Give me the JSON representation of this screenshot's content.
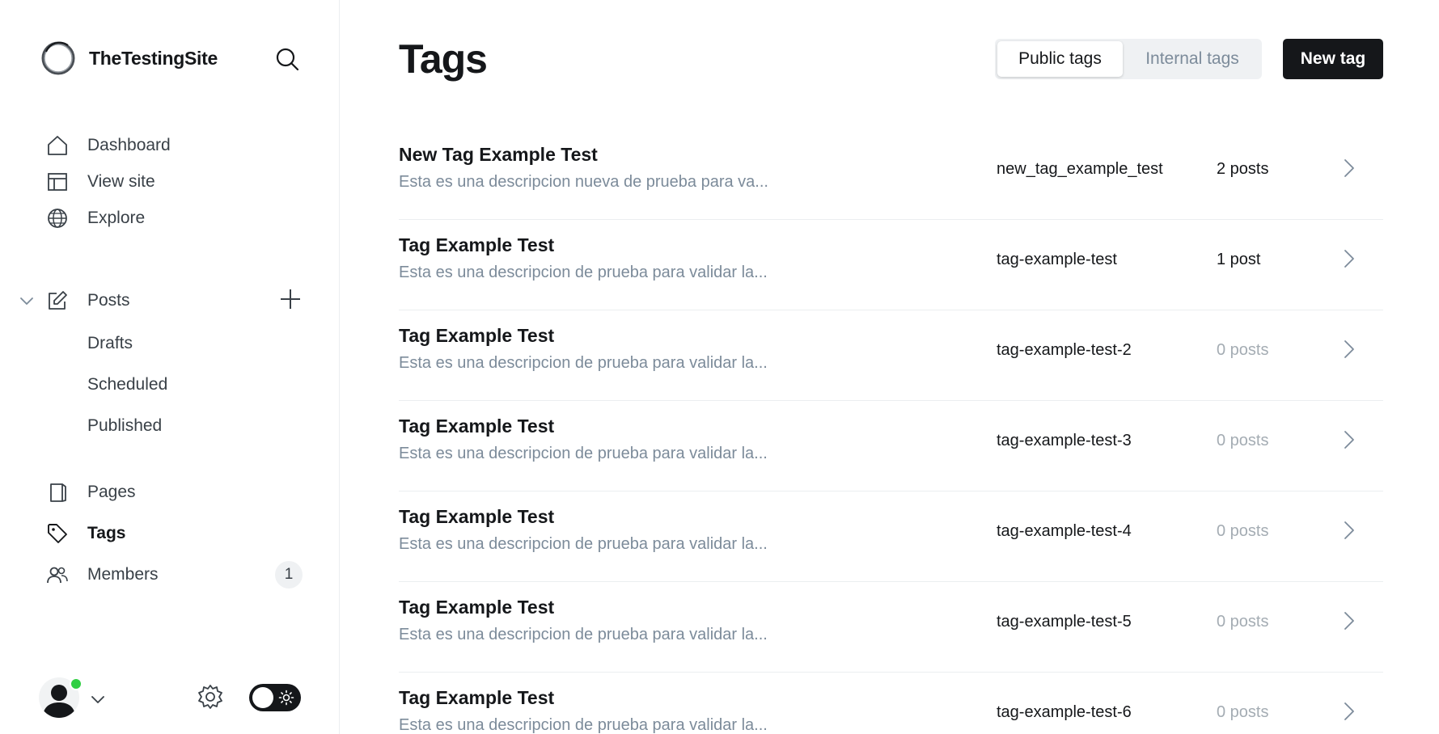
{
  "site": {
    "name": "TheTestingSite"
  },
  "nav": {
    "dashboard": "Dashboard",
    "view_site": "View site",
    "explore": "Explore",
    "posts": "Posts",
    "drafts": "Drafts",
    "scheduled": "Scheduled",
    "published": "Published",
    "pages": "Pages",
    "tags": "Tags",
    "members": "Members",
    "members_count": "1",
    "active_item": "tags"
  },
  "header": {
    "title": "Tags",
    "tabs": [
      {
        "label": "Public tags",
        "active": true
      },
      {
        "label": "Internal tags",
        "active": false
      }
    ],
    "new_tag_label": "New tag"
  },
  "tags": [
    {
      "name": "New Tag Example Test",
      "description": "Esta es una descripcion nueva de prueba para va...",
      "slug": "new_tag_example_test",
      "count": "2 posts",
      "has_posts": true
    },
    {
      "name": "Tag Example Test",
      "description": "Esta es una descripcion de prueba para validar la...",
      "slug": "tag-example-test",
      "count": "1 post",
      "has_posts": true
    },
    {
      "name": "Tag Example Test",
      "description": "Esta es una descripcion de prueba para validar la...",
      "slug": "tag-example-test-2",
      "count": "0 posts",
      "has_posts": false
    },
    {
      "name": "Tag Example Test",
      "description": "Esta es una descripcion de prueba para validar la...",
      "slug": "tag-example-test-3",
      "count": "0 posts",
      "has_posts": false
    },
    {
      "name": "Tag Example Test",
      "description": "Esta es una descripcion de prueba para validar la...",
      "slug": "tag-example-test-4",
      "count": "0 posts",
      "has_posts": false
    },
    {
      "name": "Tag Example Test",
      "description": "Esta es una descripcion de prueba para validar la...",
      "slug": "tag-example-test-5",
      "count": "0 posts",
      "has_posts": false
    },
    {
      "name": "Tag Example Test",
      "description": "Esta es una descripcion de prueba para validar la...",
      "slug": "tag-example-test-6",
      "count": "0 posts",
      "has_posts": false
    }
  ],
  "colors": {
    "accent": "#15171a",
    "muted_text": "#7c8b9a",
    "online_status": "#30cf43"
  },
  "icons": {
    "logo": "site-logo-icon",
    "search": "search-icon",
    "dashboard": "home-icon",
    "view_site": "layout-icon",
    "explore": "globe-icon",
    "posts": "pencil-square-icon",
    "pages": "page-icon",
    "tags": "tag-icon",
    "members": "users-icon",
    "settings": "gear-icon",
    "theme": "sun-icon",
    "row_arrow": "chevron-right-icon"
  }
}
